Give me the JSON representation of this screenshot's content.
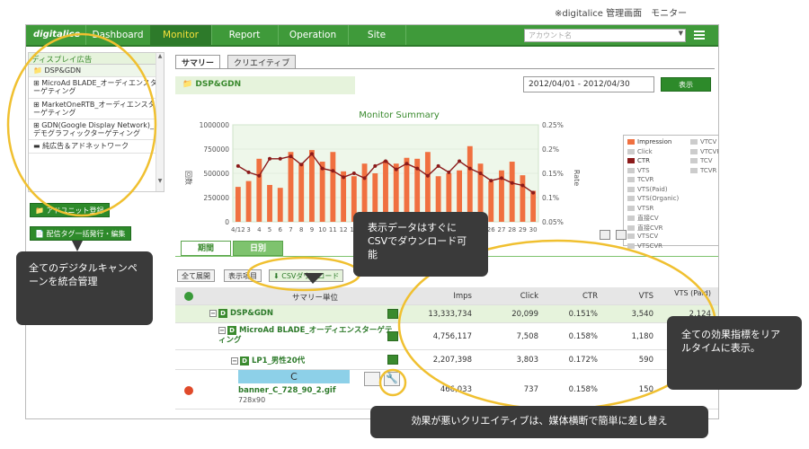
{
  "caption": "※digitalice 管理画面　モニター",
  "nav": {
    "logo": "digitalice",
    "items": [
      "Dashboard",
      "Monitor",
      "Report",
      "Operation",
      "Site"
    ],
    "active": "Monitor",
    "account_placeholder": "アカウント名"
  },
  "sidebar": {
    "header": "ディスプレイ広告",
    "items": [
      "DSP&GDN",
      "MicroAd BLADE_オーディエンスターゲティング",
      "MarketOneRTB_オーディエンスターゲティング",
      "GDN(Google Display Network)_デモグラフィックターゲティング",
      "純広告＆アドネットワーク"
    ],
    "buttons": [
      "アドユニット登録",
      "配信タグ一括発行・編集"
    ]
  },
  "tabs": [
    "サマリー",
    "クリエイティブ"
  ],
  "group_label": "DSP&GDN",
  "date_range": "2012/04/01 - 2012/04/30",
  "show_button": "表示",
  "chart_data": {
    "type": "bar",
    "title": "Monitor Summary",
    "ylabel": "回数",
    "y2label": "Rate",
    "ylim": [
      0,
      1000000
    ],
    "y2lim": [
      0.05,
      0.25
    ],
    "yticks": [
      "1000000",
      "750000",
      "500000",
      "250000",
      "0"
    ],
    "y2ticks": [
      "0.25%",
      "0.2%",
      "0.15%",
      "0.1%",
      "0.05%"
    ],
    "categories": [
      "4/12",
      "3",
      "4",
      "5",
      "6",
      "7",
      "8",
      "9",
      "10",
      "11",
      "12",
      "13",
      "14",
      "15",
      "16",
      "17",
      "18",
      "19",
      "20",
      "21",
      "22",
      "23",
      "24",
      "25",
      "26",
      "27",
      "28",
      "29",
      "30"
    ],
    "series": [
      {
        "name": "Impression",
        "type": "bar",
        "color": "#f07040",
        "values": [
          360000,
          420000,
          650000,
          380000,
          350000,
          720000,
          600000,
          740000,
          620000,
          720000,
          520000,
          470000,
          600000,
          500000,
          630000,
          600000,
          660000,
          650000,
          720000,
          470000,
          500000,
          530000,
          780000,
          600000,
          420000,
          530000,
          620000,
          480000,
          320000
        ]
      },
      {
        "name": "CTR",
        "type": "line",
        "color": "#8b1a1a",
        "values": [
          0.165,
          0.152,
          0.145,
          0.18,
          0.18,
          0.185,
          0.168,
          0.19,
          0.16,
          0.155,
          0.142,
          0.15,
          0.14,
          0.165,
          0.175,
          0.158,
          0.17,
          0.16,
          0.145,
          0.165,
          0.152,
          0.175,
          0.16,
          0.15,
          0.135,
          0.14,
          0.13,
          0.125,
          0.11
        ]
      }
    ],
    "legend": [
      "Impression",
      "VTCV",
      "Click",
      "VTCVR",
      "CTR",
      "TCV",
      "VTS",
      "TCVR",
      "VTS(Paid)",
      "VTS(Organic)",
      "VTSR",
      "直接CV",
      "直接CVR",
      "VTSCV",
      "VTSCVR"
    ],
    "legend_position": "right",
    "colors": {
      "bar": "#f07040",
      "line": "#8b1a1a",
      "plot_bg": "#eef7ea"
    }
  },
  "lower_tabs": [
    "期間",
    "日別"
  ],
  "toolbar": {
    "expand_all": "全て展開",
    "display_items": "表示項目",
    "csv": "CSVダウンロード"
  },
  "table": {
    "columns": [
      "サマリー単位",
      "Imps",
      "Click",
      "CTR",
      "VTS",
      "VTS (Paid)"
    ],
    "rows": [
      {
        "name": "DSP&GDN",
        "imps": "13,333,734",
        "click": "20,099",
        "ctr": "0.151%",
        "vts": "3,540",
        "vts_paid": "2,124"
      },
      {
        "name": "MicroAd BLADE_オーディエンスターゲティング",
        "imps": "4,756,117",
        "click": "7,508",
        "ctr": "0.158%",
        "vts": "1,180",
        "vts_paid": ""
      },
      {
        "name": "LP1_男性20代",
        "imps": "2,207,398",
        "click": "3,803",
        "ctr": "0.172%",
        "vts": "590",
        "vts_paid": ""
      },
      {
        "name": "banner_C_728_90_2.gif",
        "size": "728x90",
        "banner_label": "C",
        "imps": "466,033",
        "click": "737",
        "ctr": "0.158%",
        "vts": "150",
        "vts_paid": ""
      }
    ]
  },
  "callouts": {
    "integrated": "全てのデジタルキャンペーンを統合管理",
    "csv": "表示データはすぐにCSVでダウンロード可能",
    "realtime": "全ての効果指標をリアルタイムに表示。",
    "swap": "効果が悪いクリエイティブは、媒体横断で簡単に差し替え"
  }
}
